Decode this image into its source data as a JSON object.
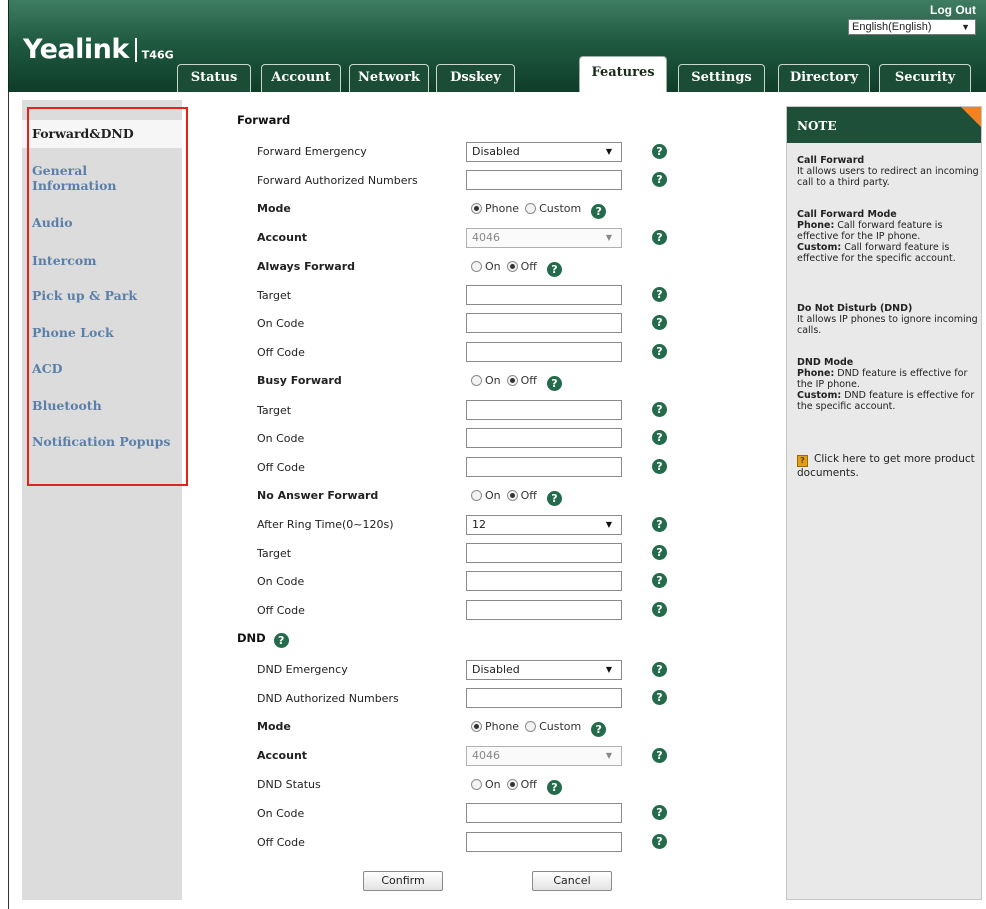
{
  "header": {
    "brand": "Yealink",
    "model": "T46G",
    "logout": "Log Out",
    "language": "English(English)"
  },
  "tabs": [
    "Status",
    "Account",
    "Network",
    "Dsskey",
    "Features",
    "Settings",
    "Directory",
    "Security"
  ],
  "active_tab": "Features",
  "nav": {
    "items": [
      "Forward&DND",
      "General\nInformation",
      "Audio",
      "Intercom",
      "Pick up & Park",
      "Phone Lock",
      "ACD",
      "Bluetooth",
      "Notification Popups"
    ],
    "active": "Forward&DND"
  },
  "forward": {
    "title": "Forward",
    "emergency_label": "Forward Emergency",
    "emergency_value": "Disabled",
    "authorized_label": "Forward Authorized Numbers",
    "mode_label": "Mode",
    "mode_phone": "Phone",
    "mode_custom": "Custom",
    "account_label": "Account",
    "account_value": "4046",
    "always_label": "Always Forward",
    "busy_label": "Busy Forward",
    "noanswer_label": "No Answer Forward",
    "on": "On",
    "off": "Off",
    "target_label": "Target",
    "oncode_label": "On Code",
    "offcode_label": "Off Code",
    "ringtime_label": "After Ring Time(0~120s)",
    "ringtime_value": "12"
  },
  "dnd": {
    "title": "DND",
    "emergency_label": "DND Emergency",
    "emergency_value": "Disabled",
    "authorized_label": "DND Authorized Numbers",
    "mode_label": "Mode",
    "mode_phone": "Phone",
    "mode_custom": "Custom",
    "account_label": "Account",
    "account_value": "4046",
    "status_label": "DND Status",
    "on": "On",
    "off": "Off",
    "oncode_label": "On Code",
    "offcode_label": "Off Code"
  },
  "buttons": {
    "confirm": "Confirm",
    "cancel": "Cancel"
  },
  "note": {
    "title": "NOTE",
    "cf_head": "Call Forward",
    "cf_text": "It allows users to redirect an incoming call to a third party.",
    "cfm_head": "Call Forward Mode",
    "cfm_phone_key": "Phone:",
    "cfm_phone_text": "Call forward feature is effective for the IP phone.",
    "cfm_custom_key": "Custom:",
    "cfm_custom_text": "Call forward feature is effective for the specific account.",
    "dnd_head": "Do Not Disturb (DND)",
    "dnd_text": "It allows IP phones to ignore incoming calls.",
    "dndm_head": "DND Mode",
    "dndm_phone_key": "Phone:",
    "dndm_phone_text": "DND feature is effective for the IP phone.",
    "dndm_custom_key": "Custom:",
    "dndm_custom_text": "DND feature is effective for the specific account.",
    "doc_link": "Click here to get more product documents."
  },
  "icons": {
    "help": "help-icon",
    "dropdown": "dropdown-arrow-icon",
    "document": "document-icon"
  },
  "colors": {
    "header_green": "#1f5a41",
    "nav_link": "#5b7fa8",
    "highlight_box": "#e2231a",
    "note_accent": "#f58220"
  }
}
